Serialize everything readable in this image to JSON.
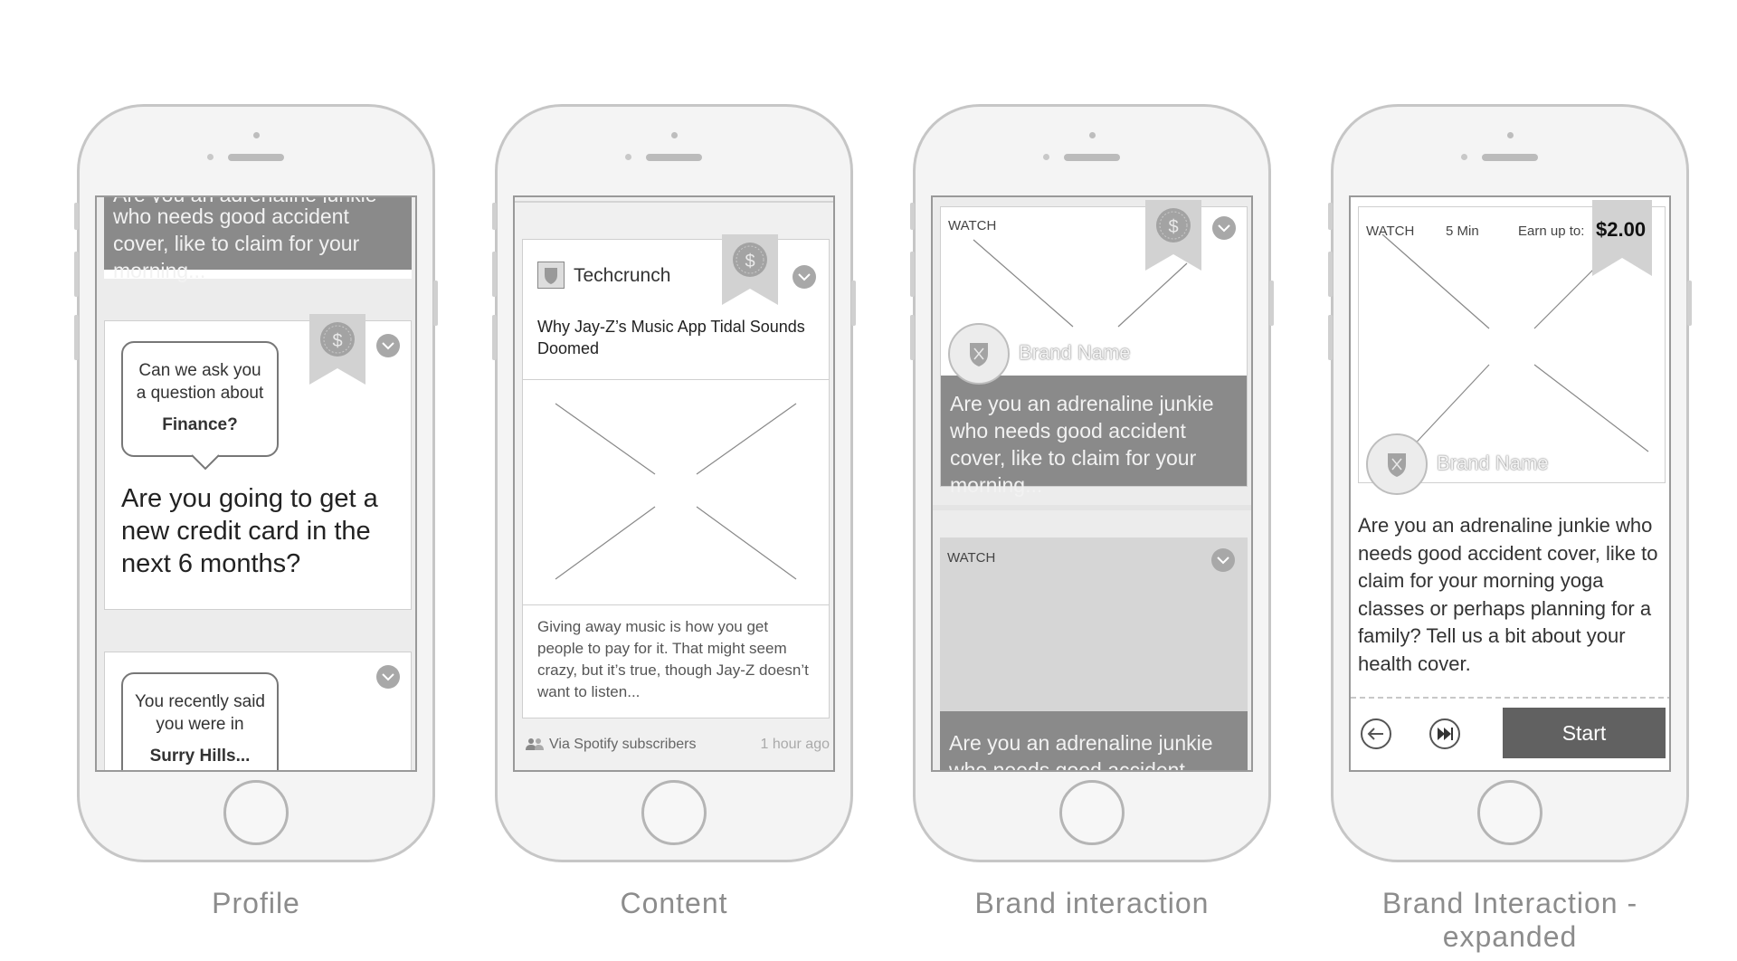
{
  "captions": {
    "profile": "Profile",
    "content": "Content",
    "brand": "Brand interaction",
    "expanded": "Brand Interaction - expanded"
  },
  "profile": {
    "top_card_partial": "Are you an adrenaline junkie",
    "top_card_text": "who needs good accident cover, like to claim for your morning...",
    "bubble1_line1": "Can we ask you",
    "bubble1_line2": "a question about",
    "bubble1_bold": "Finance?",
    "question": "Are you going to get a new credit card in the next 6 months?",
    "bubble2_line1": "You recently said",
    "bubble2_line2": "you were in",
    "bubble2_bold": "Surry Hills..."
  },
  "content": {
    "source": "Techcrunch",
    "headline": "Why Jay-Z’s Music App Tidal Sounds Doomed",
    "excerpt": "Giving away music is how you get people to pay for it. That might seem crazy, but it’s true, though Jay-Z doesn’t want to listen...",
    "via": "Via Spotify subscribers",
    "time": "1 hour ago"
  },
  "brand": {
    "watch_label": "WATCH",
    "brand_name": "Brand Name",
    "card1_text": "Are you an adrenaline junkie who needs good accident cover, like to claim for your morning...",
    "watch_label2": "WATCH",
    "card2_text": "Are you an adrenaline junkie who needs good accident cover"
  },
  "expanded": {
    "watch_label": "WATCH",
    "duration": "5 Min",
    "earn_label": "Earn up to:",
    "earn_amount": "$2.00",
    "brand_name": "Brand Name",
    "body": "Are you an adrenaline junkie who needs good accident cover, like to claim for your morning yoga classes or perhaps planning for a family? Tell us a bit about your health cover.",
    "start_label": "Start"
  },
  "icons": {
    "dollar": "$",
    "chevron": "chevron-down-icon",
    "back": "arrow-left-icon",
    "skip": "fast-forward-icon",
    "shield": "shield-icon",
    "users": "users-icon"
  },
  "colors": {
    "dark_bar": "#8a8a8a",
    "ribbon": "#d2d2d2",
    "start_button": "#616161"
  }
}
